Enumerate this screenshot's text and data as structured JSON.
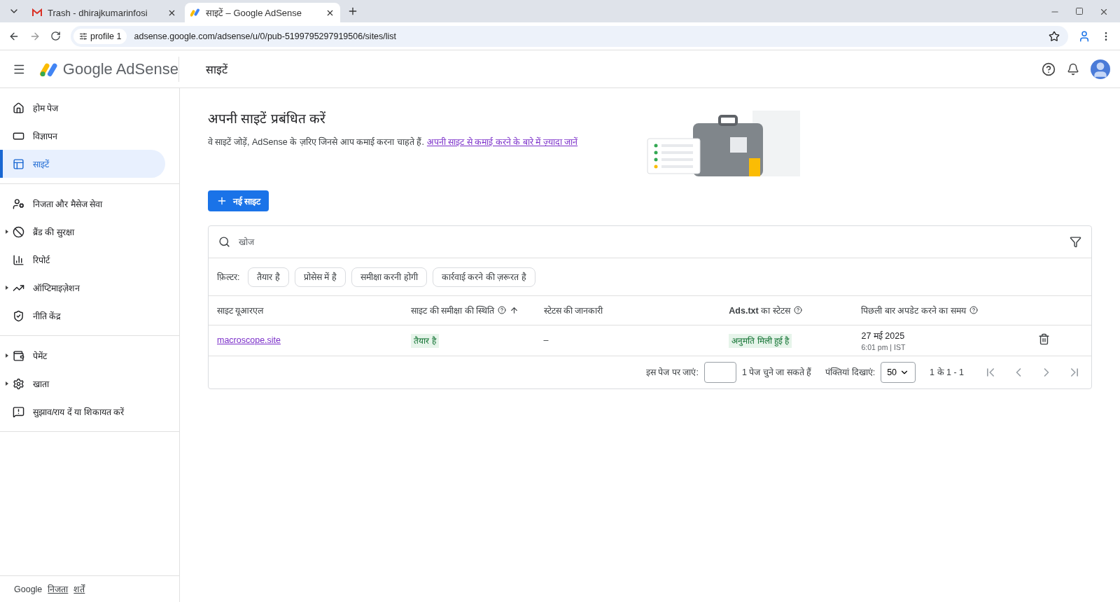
{
  "browser": {
    "tabs": [
      {
        "title": "Trash - dhirajkumarinfosi",
        "selected": false
      },
      {
        "title": "साइटें – Google AdSense",
        "selected": true
      }
    ],
    "profile_chip": "profile 1",
    "url": "adsense.google.com/adsense/u/0/pub-5199795297919506/sites/list"
  },
  "header": {
    "product": "Google AdSense",
    "page_title": "साइटें"
  },
  "sidebar": {
    "sections": [
      {
        "items": [
          {
            "label": "होम पेज",
            "selected": false,
            "expandable": false
          },
          {
            "label": "विज्ञापन",
            "selected": false,
            "expandable": false
          },
          {
            "label": "साइटें",
            "selected": true,
            "expandable": false
          }
        ]
      },
      {
        "items": [
          {
            "label": "निजता और मैसेज सेवा",
            "selected": false,
            "expandable": false
          },
          {
            "label": "ब्रैंड की सुरक्षा",
            "selected": false,
            "expandable": true
          },
          {
            "label": "रिपोर्ट",
            "selected": false,
            "expandable": false
          },
          {
            "label": "ऑप्टिमाइज़ेशन",
            "selected": false,
            "expandable": true
          },
          {
            "label": "नीति केंद्र",
            "selected": false,
            "expandable": false
          }
        ]
      },
      {
        "items": [
          {
            "label": "पेमेंट",
            "selected": false,
            "expandable": true
          },
          {
            "label": "खाता",
            "selected": false,
            "expandable": true
          },
          {
            "label": "सुझाव/राय दें या शिकायत करें",
            "selected": false,
            "expandable": false
          }
        ]
      }
    ],
    "footer": {
      "brand": "Google",
      "links": [
        "निजता",
        "शर्तें"
      ]
    }
  },
  "intro": {
    "title": "अपनी साइटें प्रबंधित करें",
    "text": "वे साइटें जोड़ें, AdSense के ज़रिए जिनसे आप कमाई करना चाहते हैं.",
    "link": "अपनी साइट से कमाई करने के बारे में ज़्यादा जानें"
  },
  "new_site_button": "नई साइट",
  "search": {
    "placeholder": "खोज"
  },
  "filters": {
    "label": "फ़िल्टर:",
    "chips": [
      {
        "label": "तैयार है",
        "selected": false
      },
      {
        "label": "प्रोसेस में है",
        "selected": false
      },
      {
        "label": "समीक्षा करनी होगी",
        "selected": false
      },
      {
        "label": "कार्रवाई करने की ज़रूरत है",
        "selected": false
      }
    ]
  },
  "table": {
    "columns": [
      {
        "label": "साइट यूआरएल",
        "help": false,
        "sorted": false
      },
      {
        "label": "साइट की समीक्षा की स्थिति",
        "help": true,
        "sorted": true
      },
      {
        "label": "स्टेटस की जानकारी",
        "help": false,
        "sorted": false
      },
      {
        "label": "**Ads.txt** का स्टेटस",
        "help": true,
        "sorted": false
      },
      {
        "label": "पिछली बार अपडेट करने का समय",
        "help": true,
        "sorted": false
      }
    ],
    "rows": [
      {
        "url": "macroscope.site",
        "review_status": "तैयार है",
        "status_info": "–",
        "ads_txt": "अनुमति मिली हुई है",
        "updated_date": "27 मई 2025",
        "updated_time": "6:01 pm | IST"
      }
    ]
  },
  "pagination": {
    "goto_label": "इस पेज पर जाएं:",
    "pages_note": "1 पेज चुने जा सकते हैं",
    "rows_label": "पंक्तियां दिखाएं:",
    "rows_value": "50",
    "range": "1 के 1 - 1"
  }
}
